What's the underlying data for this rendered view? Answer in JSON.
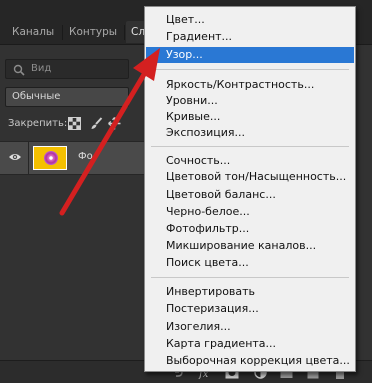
{
  "tabs": [
    {
      "label": "Каналы"
    },
    {
      "label": "Контуры"
    },
    {
      "label": "Сл"
    }
  ],
  "filter": {
    "label": "Вид"
  },
  "blend_mode": {
    "value": "Обычные"
  },
  "lock": {
    "label": "Закрепить:"
  },
  "layer": {
    "name": "Фо"
  },
  "menu": {
    "group1": [
      {
        "label": "Цвет..."
      },
      {
        "label": "Градиент..."
      },
      {
        "label": "Узор..."
      }
    ],
    "group2": [
      {
        "label": "Яркость/Контрастность..."
      },
      {
        "label": "Уровни..."
      },
      {
        "label": "Кривые..."
      },
      {
        "label": "Экспозиция..."
      }
    ],
    "group3": [
      {
        "label": "Сочность..."
      },
      {
        "label": "Цветовой тон/Насыщенность..."
      },
      {
        "label": "Цветовой баланс..."
      },
      {
        "label": "Черно-белое..."
      },
      {
        "label": "Фотофильтр..."
      },
      {
        "label": "Микширование каналов..."
      },
      {
        "label": "Поиск цвета..."
      }
    ],
    "group4": [
      {
        "label": "Инвертировать"
      },
      {
        "label": "Постеризация..."
      },
      {
        "label": "Изогелия..."
      },
      {
        "label": "Карта градиента..."
      },
      {
        "label": "Выборочная коррекция цвета..."
      }
    ],
    "selected_item": "Узор..."
  },
  "colors": {
    "menu_highlight": "#2a78d4",
    "annotation_arrow": "#d42020",
    "thumbnail_fill": "#f4c000"
  }
}
